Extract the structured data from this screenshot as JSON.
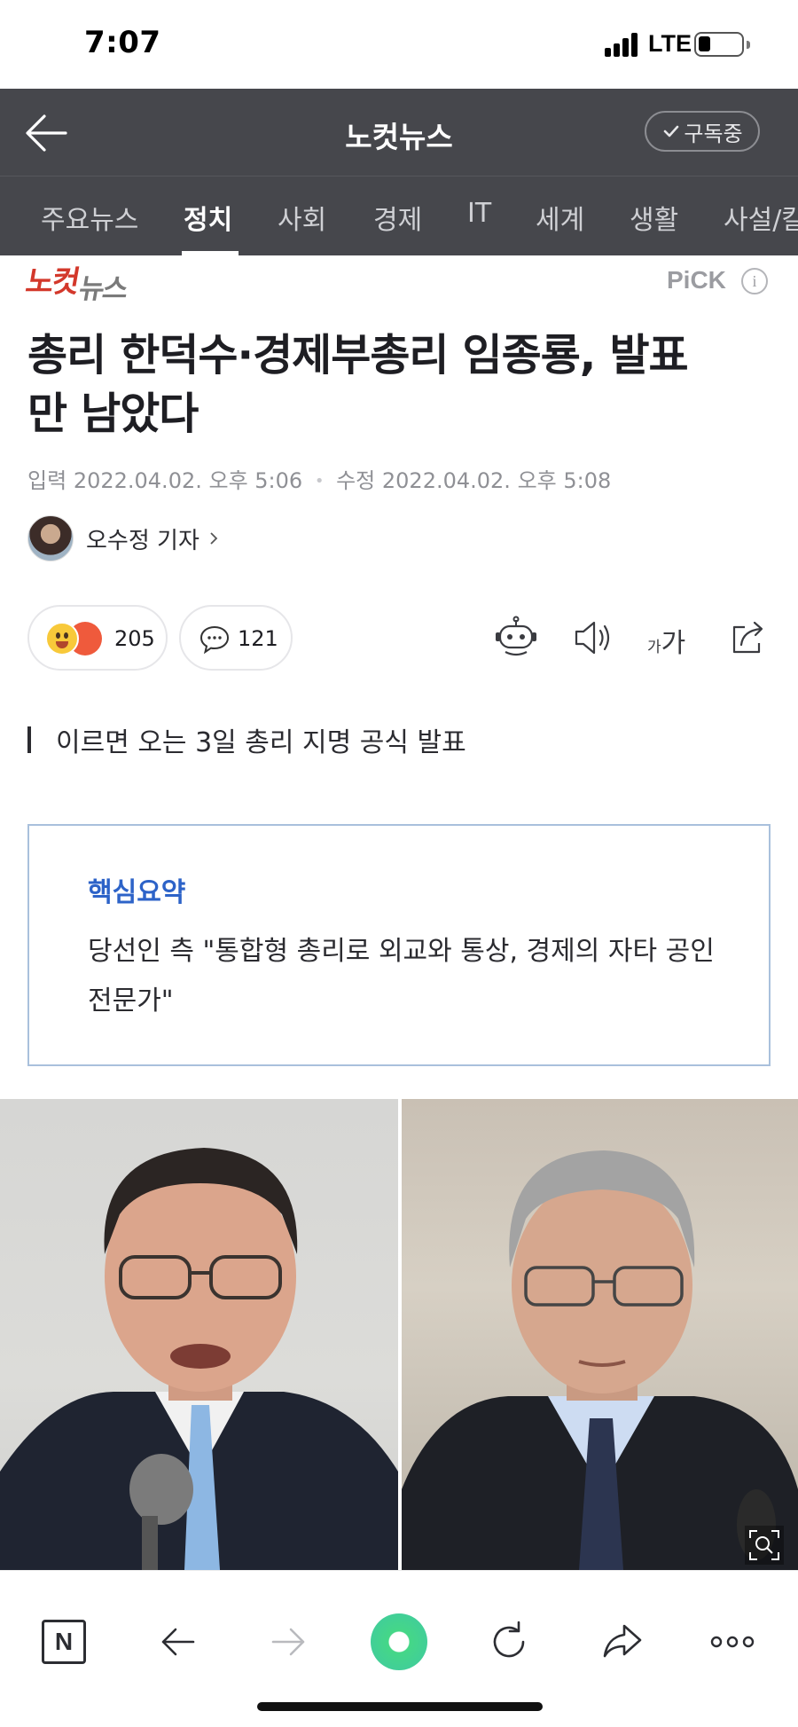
{
  "status_bar": {
    "time": "7:07",
    "network": "LTE"
  },
  "header": {
    "title": "노컷뉴스",
    "subscribe_label": "구독중"
  },
  "tabs": [
    {
      "label": "주요뉴스",
      "active": false
    },
    {
      "label": "정치",
      "active": true
    },
    {
      "label": "사회",
      "active": false
    },
    {
      "label": "경제",
      "active": false
    },
    {
      "label": "IT",
      "active": false
    },
    {
      "label": "세계",
      "active": false
    },
    {
      "label": "생활",
      "active": false
    },
    {
      "label": "사설/칼",
      "active": false
    }
  ],
  "article": {
    "press": {
      "logo_text_red": "노컷",
      "logo_text_gray": "뉴스"
    },
    "pick_label": "PiCK",
    "title_line1": "총리 한덕수·경제부총리 임종룡, 발표",
    "title_line2": "만 남았다",
    "input_label": "입력",
    "input_date": "2022.04.02. 오후 5:06",
    "modified_label": "수정",
    "modified_date": "2022.04.02. 오후 5:08",
    "reporter": "오수정 기자",
    "reactions_count": "205",
    "comments_count": "121",
    "font_size_small": "가",
    "font_size_large": "가",
    "subheadline": "이르면 오는 3일 총리 지명 공식 발표",
    "summary": {
      "title": "핵심요약",
      "text": "당선인 측 \"통합형 총리로 외교와 통상, 경제의 자타 공인 전문가\""
    }
  },
  "colors": {
    "header_bg": "#46474c",
    "press_red": "#d3382b",
    "summary_accent": "#2d63c8",
    "summary_border": "#a9c0dc",
    "green_button": "#45d787"
  }
}
